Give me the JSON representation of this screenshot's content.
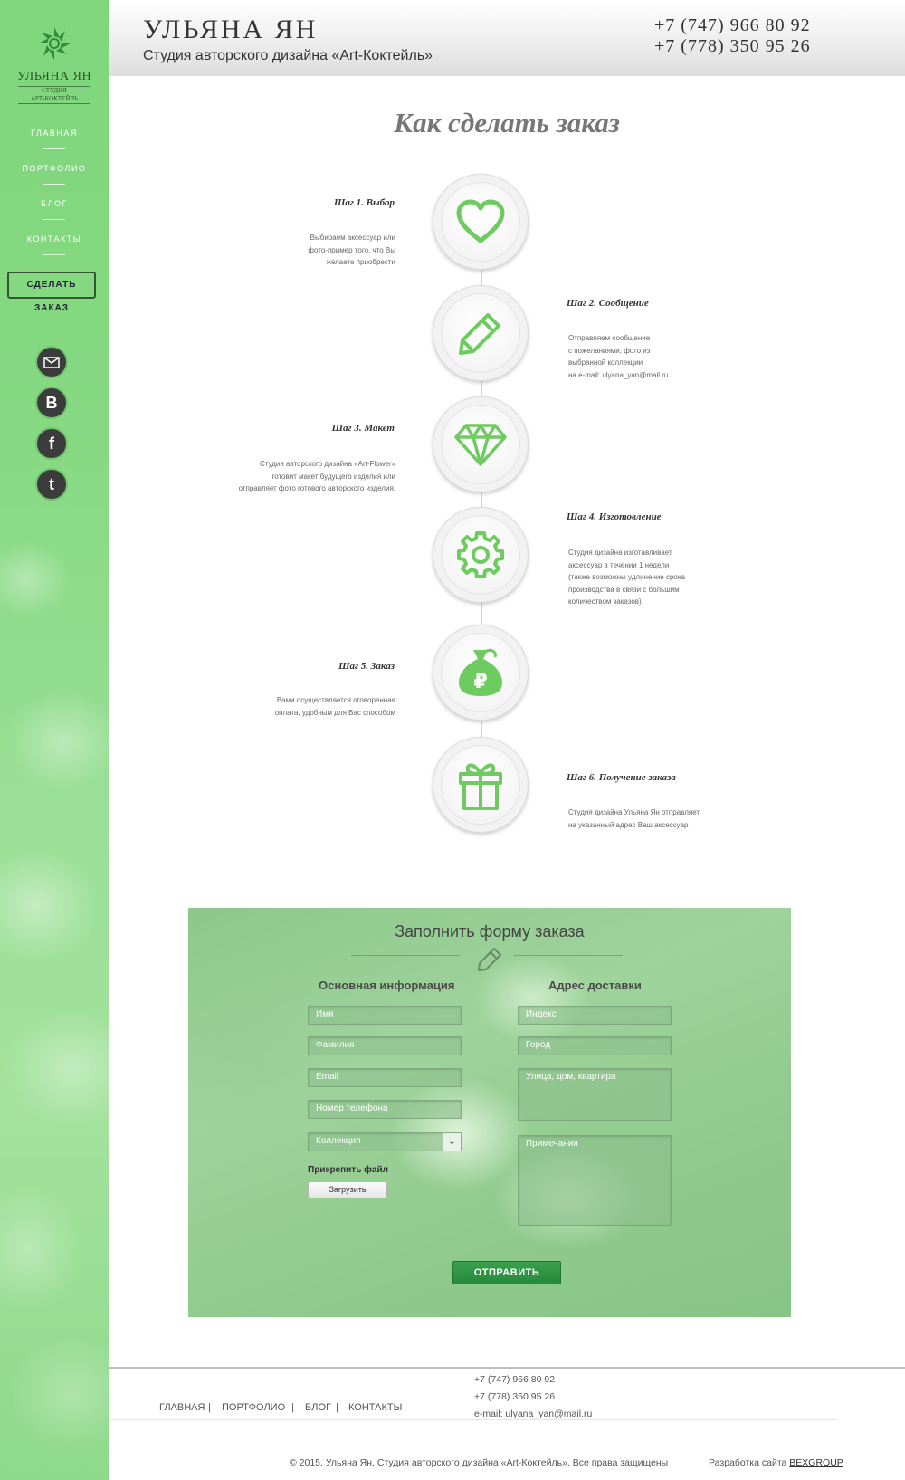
{
  "sidebar": {
    "logo": {
      "name": "УЛЬЯНА ЯН",
      "sub1": "СТУДИЯ",
      "sub2": "АРТ-КОКТЕЙЛЬ"
    },
    "nav": [
      "ГЛАВНАЯ",
      "ПОРТФОЛИО",
      "БЛОГ",
      "КОНТАКТЫ"
    ],
    "order_button": "СДЕЛАТЬ ЗАКАЗ",
    "social": [
      "mail-icon",
      "vk-icon",
      "facebook-icon",
      "twitter-icon"
    ]
  },
  "header": {
    "brand": "УЛЬЯНА ЯН",
    "tagline": "Студия авторского дизайна «Art-Коктейль»",
    "phones": [
      "+7 (747) 966 80 92",
      "+7 (778) 350 95 26"
    ]
  },
  "steps": {
    "title": "Как сделать заказ",
    "items": [
      {
        "title": "Шаг 1. Выбор",
        "desc": [
          "Выбираем аксессуар или",
          "фото-пример того, что Вы",
          "желаете приобрести"
        ],
        "icon": "heart-icon"
      },
      {
        "title": "Шаг 2. Сообщение",
        "desc": [
          "Отправляем сообщение",
          "с пожеланиями, фото из",
          "выбранной коллекции",
          "на e-mail: ulyana_yan@mail.ru"
        ],
        "icon": "pencil-icon"
      },
      {
        "title": "Шаг 3. Макет",
        "desc": [
          "Студия авторского дизайна «Art-Flower»",
          "готовит макет будущего изделия или",
          "отправляет фото готового  авторского изделия."
        ],
        "icon": "diamond-icon"
      },
      {
        "title": "Шаг 4. Изготовление",
        "desc": [
          "Студия дизайна изготавливает",
          "аксессуар в течении 1 недели",
          "(также возможны удлинение срока",
          "производства в связи с большим",
          "количеством заказов)"
        ],
        "icon": "gear-icon"
      },
      {
        "title": "Шаг 5. Заказ",
        "desc": [
          "Вами осуществляется оговоренная",
          "оплата, удобным для Вас способом"
        ],
        "icon": "money-bag-icon",
        "currency": "₽"
      },
      {
        "title": "Шаг 6. Получение заказа",
        "desc": [
          "Студия дизайна Ульяна Ян отправляет",
          "на указанный  адрес  Ваш аксессуар"
        ],
        "icon": "gift-icon"
      }
    ]
  },
  "form": {
    "title": "Заполнить форму заказа",
    "main_title": "Основная информация",
    "delivery_title": "Адрес доставки",
    "fields": {
      "name": "Имя",
      "surname": "Фамилия",
      "email": "Email",
      "phone": "Номер телефона",
      "collection": "Коллекция",
      "index": "Индекс",
      "city": "Город",
      "street": "Улица, дом, квартира",
      "notes": "Примечания"
    },
    "attach_label": "Прикрепить файл",
    "upload_button": "Загрузить",
    "submit": "ОТПРАВИТЬ"
  },
  "footer": {
    "nav": [
      "ГЛАВНАЯ",
      "ПОРТФОЛИО",
      "БЛОГ",
      "КОНТАКТЫ"
    ],
    "separator": "|",
    "contacts": [
      "+7 (747) 966 80 92",
      "+7 (778) 350 95 26",
      "e-mail: ulyana_yan@mail.ru"
    ],
    "copyright": "© 2015. Ульяна Ян. Студия авторского дизайна «Art-Коктейль». Все права защищены",
    "dev_label": "Разработка сайта",
    "dev_link": "BEXGROUP"
  },
  "colors": {
    "accent": "#6ecb5f",
    "sidebar": "#86d982",
    "submit": "#2e9444"
  }
}
